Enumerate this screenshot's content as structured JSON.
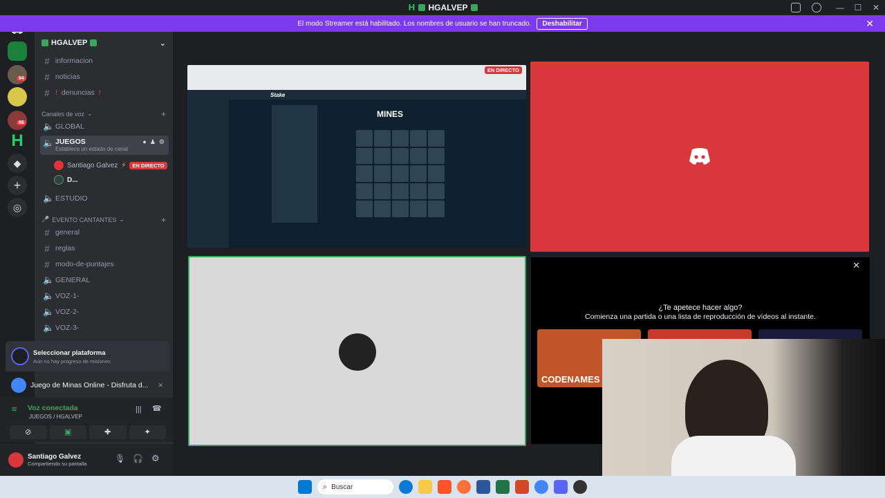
{
  "window": {
    "title": "HGALVEP"
  },
  "banner": {
    "text": "El modo Streamer está habilitado. Los nombres de usuario se han truncado.",
    "button": "Deshabilitar"
  },
  "rail": {
    "badges": [
      "64",
      "66"
    ]
  },
  "guild": {
    "name": "HGALVEP"
  },
  "channels": {
    "text_top": [
      {
        "label": "informacion"
      },
      {
        "label": "noticias"
      },
      {
        "label": "denuncias"
      }
    ],
    "voice_category": "Canales de voz",
    "voice": [
      {
        "label": "GLOBAL"
      },
      {
        "label": "JUEGOS",
        "status": "Establece un estado de canal"
      },
      {
        "label": "ESTUDIO"
      }
    ],
    "voice_users": [
      {
        "name": "Santiago Galvez",
        "live": "EN DIRECTO"
      },
      {
        "name": "D..."
      }
    ],
    "event_category": "EVENTO CANTANTES",
    "event": [
      {
        "label": "general",
        "type": "text"
      },
      {
        "label": "reglas",
        "type": "text"
      },
      {
        "label": "modo-de-puntajes",
        "type": "text"
      },
      {
        "label": "GENERAL",
        "type": "voice"
      },
      {
        "label": "VOZ-1-",
        "type": "voice"
      },
      {
        "label": "VOZ-2-",
        "type": "voice"
      },
      {
        "label": "VOZ-3-",
        "type": "voice"
      }
    ]
  },
  "quest": {
    "title": "Seleccionar plataforma",
    "subtitle": "Aún no hay progreso de misiones"
  },
  "activity": {
    "label": "Juego de Minas Online - Disfruta d..."
  },
  "voice": {
    "status": "Voz conectada",
    "location": "JUEGOS / HGALVEP"
  },
  "user": {
    "name": "Santiago Galvez",
    "status": "Compartiendo su pantalla"
  },
  "stage": {
    "live_badge": "EN DIRECTO",
    "mines_title": "MINES",
    "stake": "Stake",
    "activity_title": "¿Te apetece hacer algo?",
    "activity_sub": "Comienza una partida o una lista de reproducción de vídeos al instante.",
    "game_card": "CODENAMES"
  },
  "taskbar": {
    "search": "Buscar"
  },
  "colors": {
    "discord": "#5865f2",
    "banner": "#7c3aed",
    "live": "#da373c",
    "online": "#3ba55d"
  }
}
